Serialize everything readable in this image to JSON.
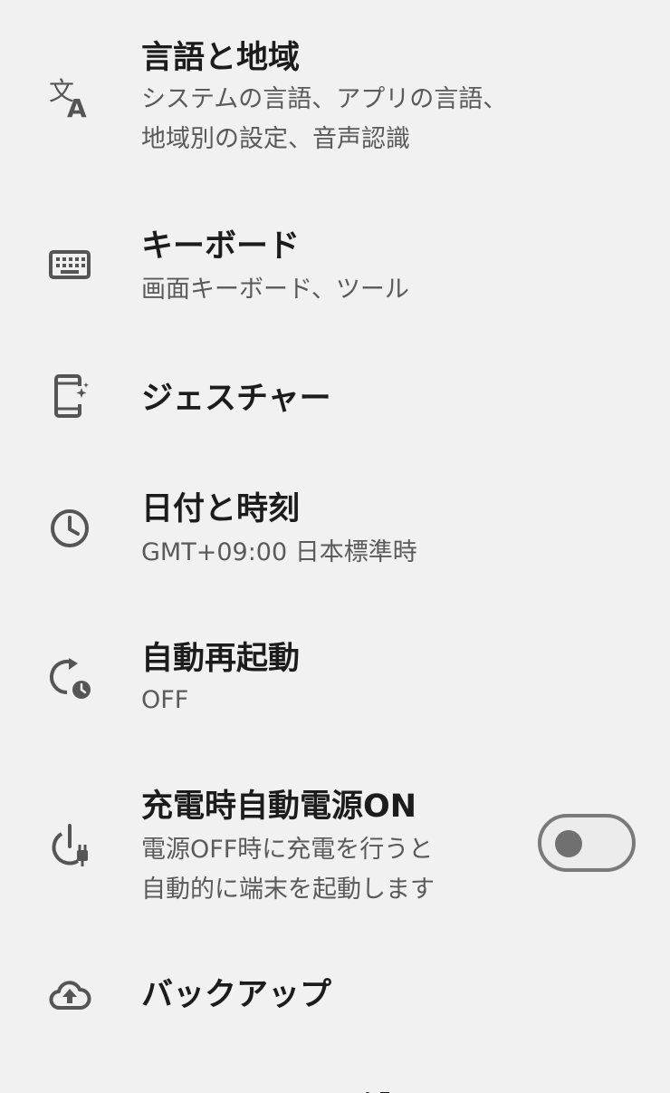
{
  "settings": {
    "items": [
      {
        "icon": "translate-icon",
        "title": "言語と地域",
        "subtitle": "システムの言語、アプリの言語、\n地域別の設定、音声認識"
      },
      {
        "icon": "keyboard-icon",
        "title": "キーボード",
        "subtitle": "画面キーボード、ツール"
      },
      {
        "icon": "gesture-phone-icon",
        "title": "ジェスチャー"
      },
      {
        "icon": "clock-icon",
        "title": "日付と時刻",
        "subtitle": "GMT+09:00 日本標準時"
      },
      {
        "icon": "restart-schedule-icon",
        "title": "自動再起動",
        "subtitle": "OFF"
      },
      {
        "icon": "power-plug-icon",
        "title": "充電時自動電源ON",
        "subtitle": "電源OFF時に充電を行うと\n自動的に端末を起動します",
        "toggle_state": "off"
      },
      {
        "icon": "cloud-upload-icon",
        "title": "バックアップ"
      }
    ]
  },
  "colors": {
    "background": "#f1f1f1",
    "title": "#1c1c1c",
    "subtitle": "#5a5a5a",
    "icon": "#555555",
    "toggle_border": "#7a7a7a",
    "toggle_knob": "#707070"
  }
}
